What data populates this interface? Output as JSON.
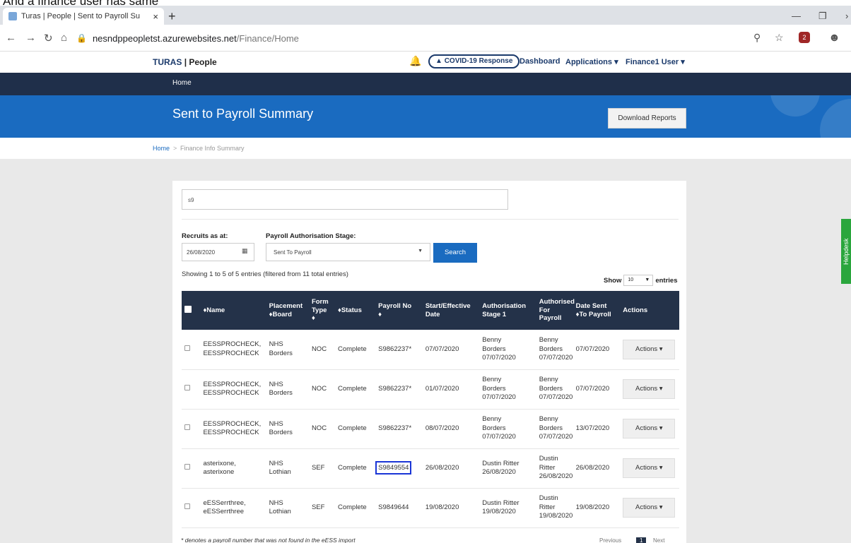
{
  "caption": "And a finance user has same",
  "browser": {
    "tab_title": "Turas | People | Sent to Payroll Su",
    "tab_close": "×",
    "new_tab": "+",
    "url_host": "nesndppeopletst.azurewebsites.net",
    "url_path": "/Finance/Home",
    "extension_badge": "2"
  },
  "topnav": {
    "brand_turas": "TURAS",
    "brand_people": "| People",
    "covid": "COVID-19 Response",
    "dashboard": "Dashboard",
    "applications": "Applications",
    "user": "Finance1 User"
  },
  "homebar": {
    "label": "Home"
  },
  "banner": {
    "title": "Sent to Payroll Summary",
    "download": "Download Reports"
  },
  "breadcrumb": {
    "home": "Home",
    "separator": ">",
    "current": "Finance Info Summary"
  },
  "filters": {
    "search_value": "s9",
    "recruits_label": "Recruits as at:",
    "recruits_date": "26/08/2020",
    "stage_label": "Payroll Authorisation Stage:",
    "stage_value": "Sent To Payroll",
    "search_button": "Search"
  },
  "listing": {
    "showing": "Showing 1 to 5 of 5 entries (filtered from 11 total entries)",
    "show_label": "Show",
    "page_length": "10",
    "entries_label": "entries"
  },
  "table": {
    "headers": {
      "name": "♦Name",
      "placement1": "Placement",
      "placement2": "♦Board",
      "form1": "Form",
      "form2": "Type",
      "form3": "♦",
      "status": "♦Status",
      "payroll1": "Payroll No",
      "payroll2": "♦",
      "start1": "Start/Effective",
      "start2": "Date",
      "auth1a": "Authorisation",
      "auth1b": "Stage 1",
      "authp1": "Authorised",
      "authp2": "For Payroll",
      "sent1": "Date Sent",
      "sent2": "♦To Payroll",
      "actions": "Actions"
    },
    "rows": [
      {
        "name1": "EESSPROCHECK,",
        "name2": "EESSPROCHECK",
        "board1": "NHS",
        "board2": "Borders",
        "form": "NOC",
        "status": "Complete",
        "payroll": "S9862237*",
        "start": "07/07/2020",
        "a1n1": "Benny",
        "a1n2": "Borders",
        "a1d": "07/07/2020",
        "apn1": "Benny",
        "apn2": "Borders",
        "apd": "07/07/2020",
        "sent": "07/07/2020",
        "action": "Actions ▾"
      },
      {
        "name1": "EESSPROCHECK,",
        "name2": "EESSPROCHECK",
        "board1": "NHS",
        "board2": "Borders",
        "form": "NOC",
        "status": "Complete",
        "payroll": "S9862237*",
        "start": "01/07/2020",
        "a1n1": "Benny",
        "a1n2": "Borders",
        "a1d": "07/07/2020",
        "apn1": "Benny",
        "apn2": "Borders",
        "apd": "07/07/2020",
        "sent": "07/07/2020",
        "action": "Actions ▾"
      },
      {
        "name1": "EESSPROCHECK,",
        "name2": "EESSPROCHECK",
        "board1": "NHS",
        "board2": "Borders",
        "form": "NOC",
        "status": "Complete",
        "payroll": "S9862237*",
        "start": "08/07/2020",
        "a1n1": "Benny",
        "a1n2": "Borders",
        "a1d": "07/07/2020",
        "apn1": "Benny",
        "apn2": "Borders",
        "apd": "07/07/2020",
        "sent": "13/07/2020",
        "action": "Actions ▾"
      },
      {
        "name1": "asterixone,",
        "name2": "asterixone",
        "board1": "NHS",
        "board2": "Lothian",
        "form": "SEF",
        "status": "Complete",
        "payroll": "S9849554",
        "start": "26/08/2020",
        "a1n1": "Dustin Ritter",
        "a1n2": "",
        "a1d": "26/08/2020",
        "apn1": "Dustin",
        "apn2": "Ritter",
        "apd": "26/08/2020",
        "sent": "26/08/2020",
        "action": "Actions ▾"
      },
      {
        "name1": "eESSerrthree,",
        "name2": "eESSerrthree",
        "board1": "NHS",
        "board2": "Lothian",
        "form": "SEF",
        "status": "Complete",
        "payroll": "S9849644",
        "start": "19/08/2020",
        "a1n1": "Dustin Ritter",
        "a1n2": "",
        "a1d": "19/08/2020",
        "apn1": "Dustin",
        "apn2": "Ritter",
        "apd": "19/08/2020",
        "sent": "19/08/2020",
        "action": "Actions ▾"
      }
    ]
  },
  "footnote": "* denotes a payroll number that was not found in the eESS import",
  "pagination": {
    "previous": "Previous",
    "page": "1",
    "next": "Next"
  },
  "helpdesk": "Helpdesk",
  "colors": {
    "navy": "#1f2f4a",
    "brand_blue": "#1a6bc0",
    "table_header": "#243249",
    "highlight": "#1a35d6",
    "helpdesk": "#2aa63d"
  },
  "icons": [
    "back-icon",
    "forward-icon",
    "reload-icon",
    "home-icon",
    "lock-icon",
    "zoom-icon",
    "star-icon",
    "profile-icon",
    "bell-icon",
    "warning-icon",
    "calendar-icon"
  ]
}
